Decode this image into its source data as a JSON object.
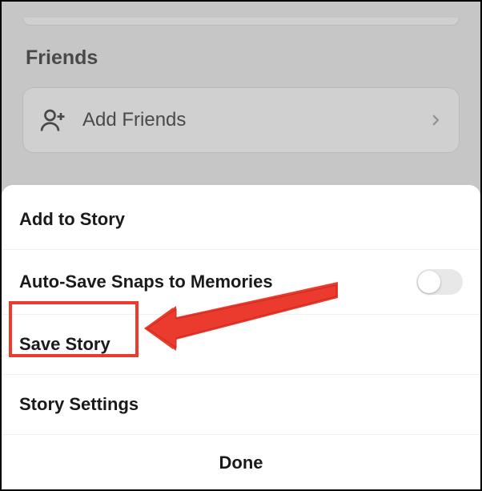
{
  "background": {
    "section_title": "Friends",
    "add_friends_label": "Add Friends"
  },
  "sheet": {
    "items": [
      {
        "label": "Add to Story",
        "has_toggle": false
      },
      {
        "label": "Auto-Save Snaps to Memories",
        "has_toggle": true,
        "toggle_on": false
      },
      {
        "label": "Save Story",
        "has_toggle": false
      },
      {
        "label": "Story Settings",
        "has_toggle": false
      }
    ],
    "done_label": "Done"
  },
  "annotation": {
    "highlight_color": "#eb3b2f",
    "arrow_color": "#eb3b2f"
  }
}
